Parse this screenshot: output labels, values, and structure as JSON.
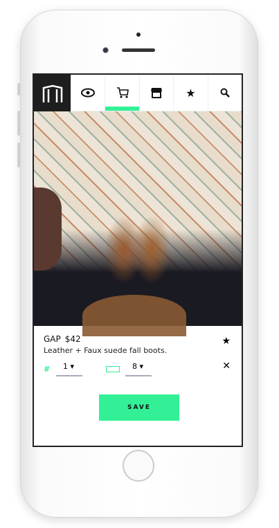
{
  "nav": {
    "tabs": [
      {
        "icon": "eye-icon",
        "glyph": "👁"
      },
      {
        "icon": "cart-icon",
        "glyph": "🛒",
        "active": true
      },
      {
        "icon": "store-icon",
        "glyph": "▦"
      },
      {
        "icon": "star-icon",
        "glyph": "★"
      },
      {
        "icon": "search-icon",
        "glyph": "⚲"
      }
    ]
  },
  "product": {
    "brand": "GAP",
    "price": "$42",
    "description": "Leather + Faux suede fall boots.",
    "quantity_symbol": "#",
    "quantity": "1 ▾",
    "size": "8 ▾",
    "star": "★",
    "close": "✕"
  },
  "save_label": "SAVE",
  "colors": {
    "accent": "#33f096",
    "logo_bg": "#1e1e1e"
  }
}
